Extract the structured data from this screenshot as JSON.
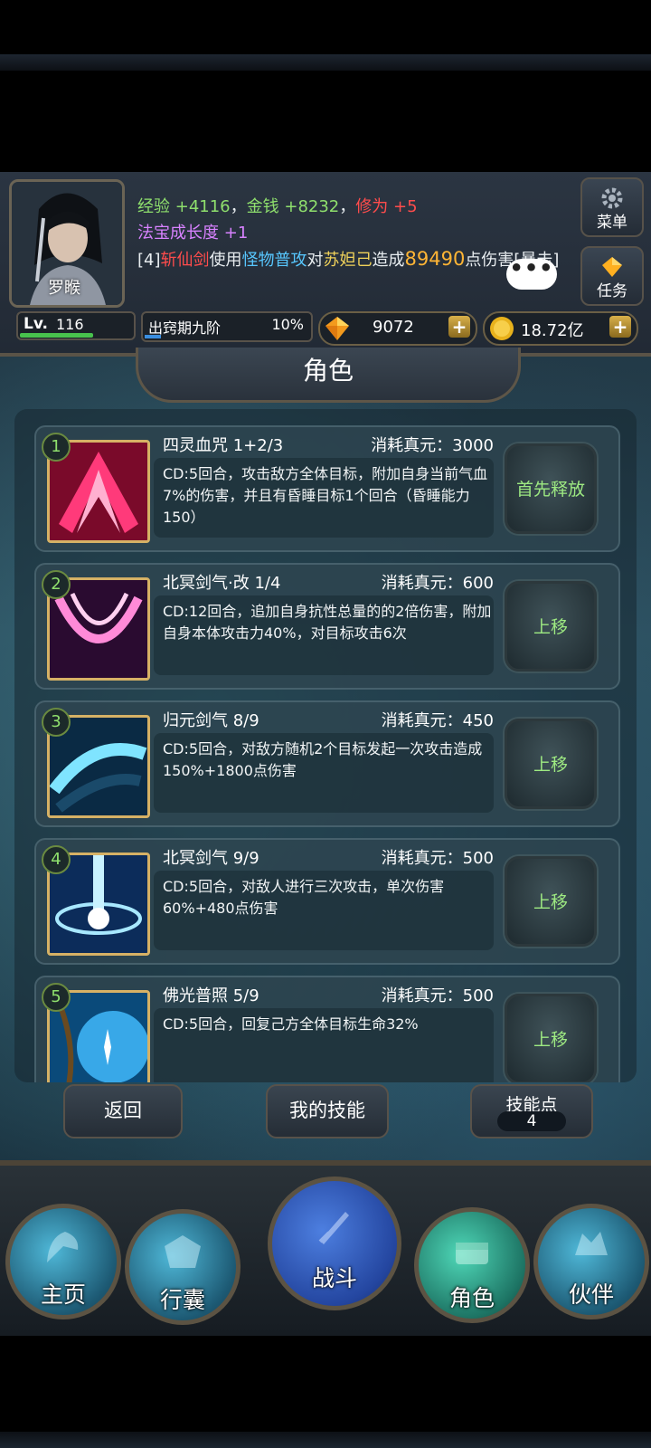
{
  "hud": {
    "player_name": "罗睺",
    "reward_line": {
      "exp_label": "经验",
      "exp_value": "+4116",
      "sep1": "，",
      "money_label": "金钱",
      "money_value": "+8232",
      "sep2": "，",
      "cult_label": "修为",
      "cult_value": "+5"
    },
    "growth_line": {
      "label": "法宝成长度",
      "value": "+1"
    },
    "log_line": {
      "prefix": "[4]",
      "actor": "斩仙剑",
      "verb1": "使用",
      "skill": "怪物普攻",
      "verb2": "对",
      "target": "苏妲己",
      "verb3": "造成",
      "damage": "89490",
      "suffix": "点伤害[暴击]"
    },
    "chat_bubble": "•••",
    "menu_label": "菜单",
    "task_label": "任务",
    "level_prefix": "Lv.",
    "level": "116",
    "level_progress": 0.65,
    "cultivation_stage": "出窍期九阶",
    "cultivation_percent": "10%",
    "gems": "9072",
    "gold": "18.72亿",
    "plus_label": "+"
  },
  "title": "角色",
  "skills": [
    {
      "index": "1",
      "name": "四灵血咒 1+2/3",
      "cost": "消耗真元：3000",
      "desc": "CD:5回合，攻击敌方全体目标，附加自身当前气血7%的伤害，并且有昏睡目标1个回合（昏睡能力150）",
      "action": "首先释放"
    },
    {
      "index": "2",
      "name": "北冥剑气·改 1/4",
      "cost": "消耗真元：600",
      "desc": "CD:12回合，追加自身抗性总量的的2倍伤害，附加自身本体攻击力40%，对目标攻击6次",
      "action": "上移"
    },
    {
      "index": "3",
      "name": "归元剑气 8/9",
      "cost": "消耗真元：450",
      "desc": "CD:5回合，对敌方随机2个目标发起一次攻击造成150%+1800点伤害",
      "action": "上移"
    },
    {
      "index": "4",
      "name": "北冥剑气 9/9",
      "cost": "消耗真元：500",
      "desc": "CD:5回合，对敌人进行三次攻击，单次伤害60%+480点伤害",
      "action": "上移"
    },
    {
      "index": "5",
      "name": "佛光普照 5/9",
      "cost": "消耗真元：500",
      "desc": "CD:5回合，回复己方全体目标生命32%",
      "action": "上移"
    }
  ],
  "buttons": {
    "back": "返回",
    "my_skills": "我的技能",
    "skill_points_label": "技能点",
    "skill_points": "4"
  },
  "nav": {
    "home": "主页",
    "bag": "行囊",
    "battle": "战斗",
    "role": "角色",
    "partner": "伙伴"
  },
  "colors": {
    "exp": "#8fe06d",
    "cultivation": "#ff4c4c",
    "growth": "#d882ff",
    "damage": "#ffb535",
    "action_text": "#9eea82"
  }
}
